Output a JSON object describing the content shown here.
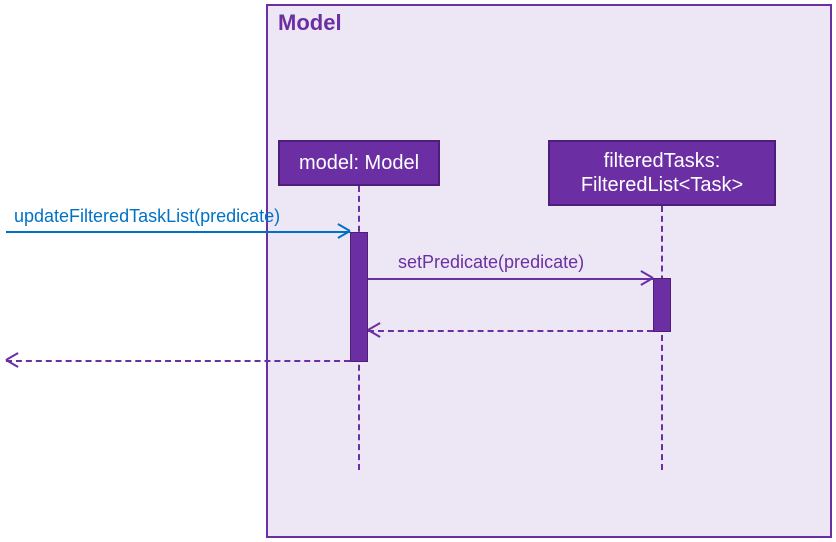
{
  "frame": {
    "label": "Model"
  },
  "participants": {
    "model": {
      "header": "model: Model"
    },
    "filteredTasks": {
      "header_l1": "filteredTasks:",
      "header_l2": "FilteredList<Task>"
    }
  },
  "messages": {
    "update": "updateFilteredTaskList(predicate)",
    "setPredicate": "setPredicate(predicate)"
  },
  "chart_data": {
    "type": "sequence_diagram",
    "frame": "Model",
    "participants": [
      {
        "id": "caller",
        "name": "(external caller)",
        "external": true
      },
      {
        "id": "model",
        "name": "model",
        "type": "Model"
      },
      {
        "id": "filteredTasks",
        "name": "filteredTasks",
        "type": "FilteredList<Task>"
      }
    ],
    "interactions": [
      {
        "from": "caller",
        "to": "model",
        "message": "updateFilteredTaskList(predicate)",
        "kind": "sync",
        "style": "solid"
      },
      {
        "from": "model",
        "to": "filteredTasks",
        "message": "setPredicate(predicate)",
        "kind": "sync",
        "style": "solid"
      },
      {
        "from": "filteredTasks",
        "to": "model",
        "message": "",
        "kind": "return",
        "style": "dashed"
      },
      {
        "from": "model",
        "to": "caller",
        "message": "",
        "kind": "return",
        "style": "dashed"
      }
    ]
  }
}
